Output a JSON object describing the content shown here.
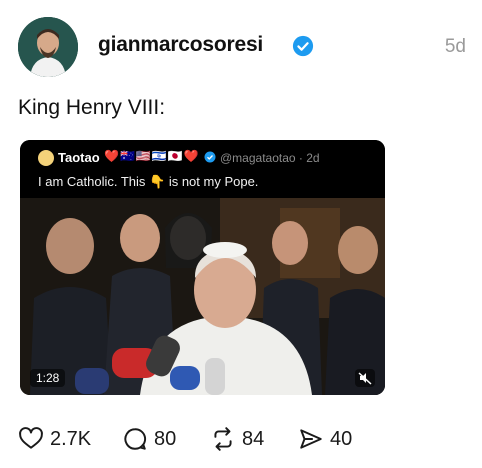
{
  "post": {
    "username": "gianmarcosoresi",
    "time": "5d",
    "text": "King Henry VIII:"
  },
  "embedded_tweet": {
    "name": "Taotao",
    "emojis": "❤️🇦🇺🇺🇸🇮🇱🇯🇵❤️",
    "handle": "@magataotao · 2d",
    "text": "I am Catholic. This 👇 is not my Pope."
  },
  "video": {
    "duration": "1:28",
    "mute_icon": "mute-icon"
  },
  "actions": {
    "likes": "2.7K",
    "replies": "80",
    "reposts": "84",
    "shares": "40"
  },
  "colors": {
    "verified": "#1d9bf0",
    "text": "#111111",
    "muted": "#9a9a9a"
  }
}
